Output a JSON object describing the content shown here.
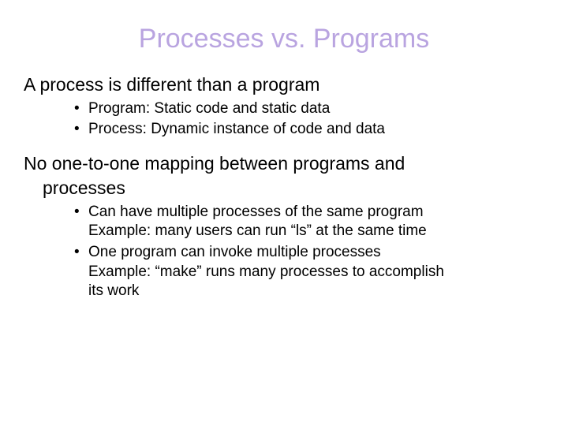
{
  "title": "Processes vs. Programs",
  "p1": "A process is different than a program",
  "b1a": "Program: Static code and static data",
  "b1b": "Process: Dynamic instance of code and data",
  "p2_line1": "No one-to-one mapping between programs and",
  "p2_line2": "processes",
  "b2a_line1": "Can have multiple processes of the same program",
  "b2a_line2": "Example: many users can run “ls” at the same time",
  "b2b_line1": "One program can invoke multiple processes",
  "b2b_line2": "Example: “make” runs many processes to accomplish",
  "b2b_line3": "its work"
}
